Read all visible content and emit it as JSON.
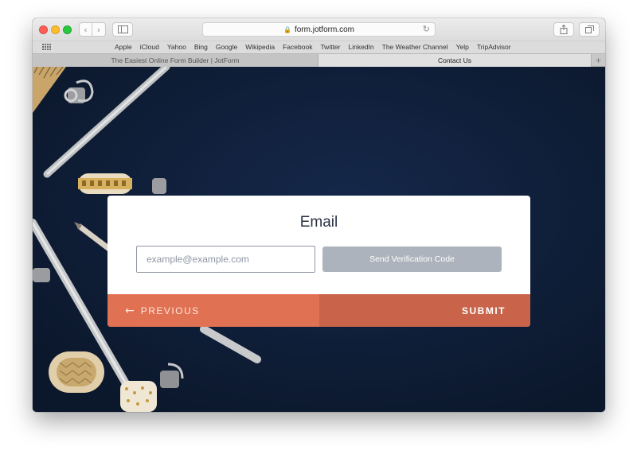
{
  "browser": {
    "url": "form.jotform.com",
    "bookmarks": [
      "Apple",
      "iCloud",
      "Yahoo",
      "Bing",
      "Google",
      "Wikipedia",
      "Facebook",
      "Twitter",
      "LinkedIn",
      "The Weather Channel",
      "Yelp",
      "TripAdvisor"
    ],
    "tabs": [
      {
        "label": "The Easiest Online Form Builder | JotForm"
      },
      {
        "label": "Contact Us"
      }
    ]
  },
  "form": {
    "title": "Email",
    "email_placeholder": "example@example.com",
    "verify_label": "Send Verification Code",
    "previous_label": "PREVIOUS",
    "submit_label": "SUBMIT"
  },
  "colors": {
    "page_background": "#0f1d35",
    "previous_button": "#e07152",
    "submit_button": "#c9644a",
    "verify_button": "#adb3bc"
  }
}
